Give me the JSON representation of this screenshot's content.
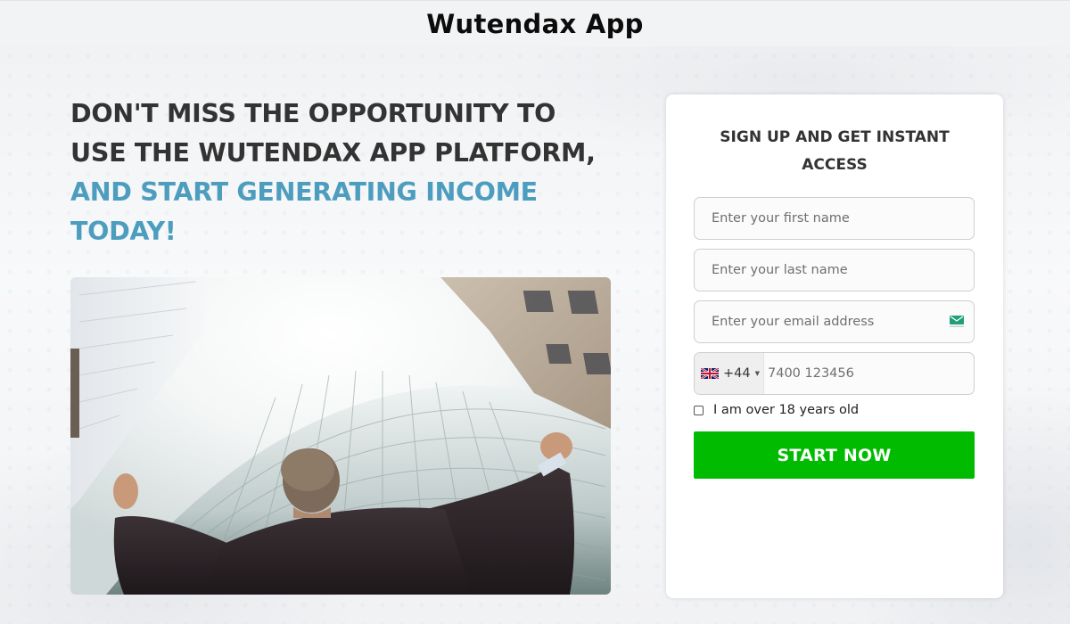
{
  "header": {
    "title": "Wutendax App"
  },
  "hero": {
    "headline_dark": [
      "DON'T MISS THE OPPORTUNITY TO",
      "USE THE WUTENDAX APP PLATFORM,"
    ],
    "headline_accent": [
      "AND START GENERATING INCOME",
      "TODAY!"
    ],
    "image_alt": "Businessman in suit with raised arms looking up at skyscrapers"
  },
  "colors": {
    "accent": "#4d9dbf",
    "headline": "#333333",
    "cta": "#00bb00"
  },
  "signup": {
    "title": "SIGN UP AND GET INSTANT ACCESS",
    "first_name": {
      "placeholder": "Enter your first name",
      "value": ""
    },
    "last_name": {
      "placeholder": "Enter your last name",
      "value": ""
    },
    "email": {
      "placeholder": "Enter your email address",
      "value": "",
      "icon": "envelope-icon"
    },
    "phone": {
      "country_flag": "united-kingdom-flag-icon",
      "dial_code": "+44",
      "placeholder": "7400 123456",
      "value": ""
    },
    "age_checkbox": {
      "label": "I am over 18 years old",
      "checked": false
    },
    "submit_label": "START NOW"
  }
}
